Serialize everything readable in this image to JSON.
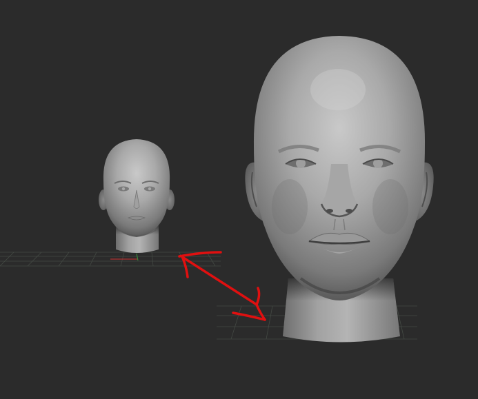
{
  "viewport": {
    "background": "#2b2b2b",
    "grid_color": "#4a4f4a",
    "axis_x_color": "#b03030",
    "axis_z_color": "#3a8a3a",
    "annotation_color": "#e01010"
  },
  "models": [
    {
      "name": "head-model-small"
    },
    {
      "name": "head-model-large"
    }
  ],
  "annotation": {
    "icon": "double-headed-arrow-icon"
  }
}
